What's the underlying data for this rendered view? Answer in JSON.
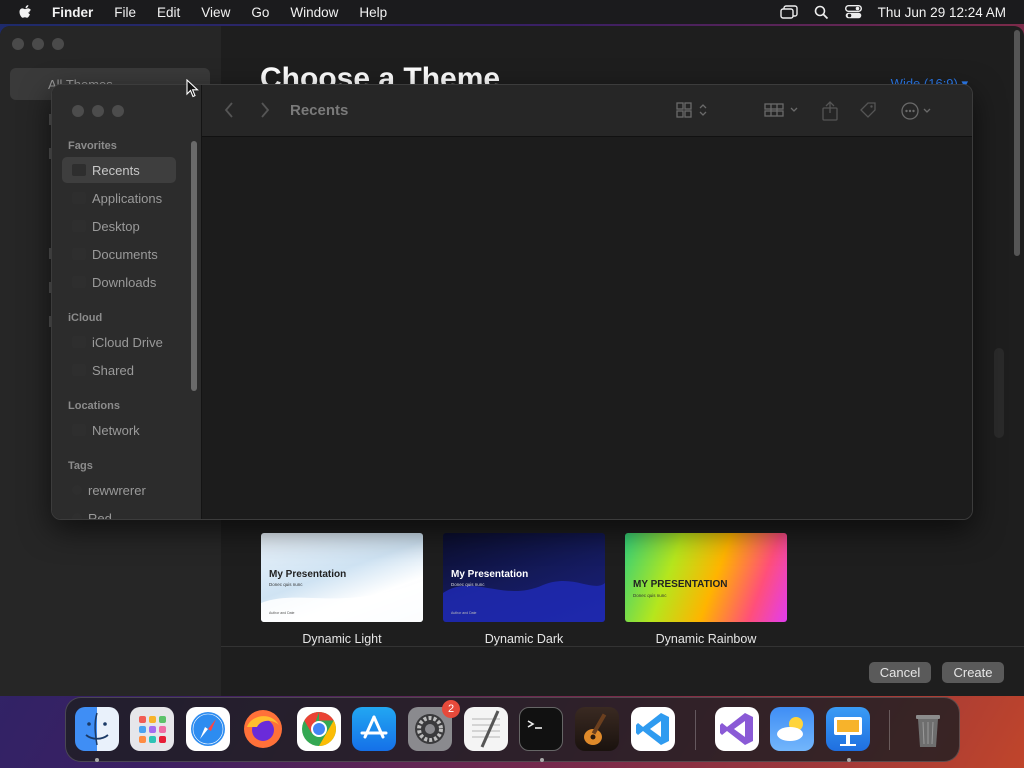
{
  "menubar": {
    "app_name": "Finder",
    "items": [
      "File",
      "Edit",
      "View",
      "Go",
      "Window",
      "Help"
    ],
    "clock": "Thu Jun 29  12:24 AM"
  },
  "keynote": {
    "search_text": "All Themes",
    "title": "Choose a Theme",
    "ratio_label": "Wide (16:9) ▾",
    "themes": [
      {
        "name": "Dynamic Light",
        "thumb_title": "My Presentation",
        "thumb_subtitle": "Donec quis nunc",
        "thumb_author": "Author and Date"
      },
      {
        "name": "Dynamic Dark",
        "thumb_title": "My Presentation",
        "thumb_subtitle": "Donec quis nunc",
        "thumb_author": "Author and Date"
      },
      {
        "name": "Dynamic Rainbow",
        "thumb_title": "MY PRESENTATION",
        "thumb_subtitle": "Donec quis nunc",
        "thumb_author": ""
      }
    ],
    "cancel_label": "Cancel",
    "create_label": "Create"
  },
  "finder": {
    "location": "Recents",
    "sidebar": {
      "favorites_header": "Favorites",
      "favorites": [
        "Recents",
        "Applications",
        "Desktop",
        "Documents",
        "Downloads"
      ],
      "icloud_header": "iCloud",
      "icloud": [
        "iCloud Drive",
        "Shared"
      ],
      "locations_header": "Locations",
      "locations": [
        "Network"
      ],
      "tags_header": "Tags",
      "tags": [
        "rewwrerer",
        "Red"
      ]
    }
  },
  "dock": {
    "apps": [
      "Finder",
      "Launchpad",
      "Safari",
      "Firefox",
      "Chrome",
      "App Store",
      "System Settings",
      "TextEdit",
      "Terminal",
      "GarageBand",
      "Visual Studio Code",
      "Visual Studio",
      "Weather",
      "Keynote",
      "Trash"
    ],
    "settings_badge": "2",
    "accent_colors": {
      "finder": "#3f8ef5",
      "chrome": "#ea4335",
      "vscode": "#2f9bf0"
    }
  }
}
